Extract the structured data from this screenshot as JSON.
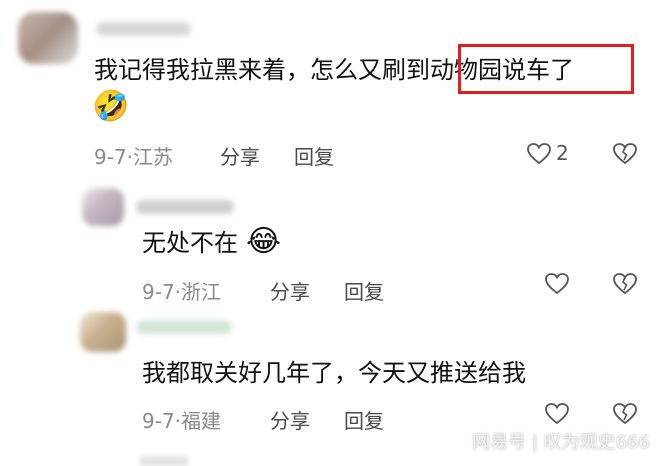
{
  "comments": [
    {
      "text_before": "我记得我拉黑来着，怎么又刷到",
      "text_highlight": "动物园说车了",
      "emoji": "🤣",
      "date": "9-7",
      "separator": "·",
      "location": "江苏",
      "share_label": "分享",
      "reply_label": "回复",
      "like_count": "2"
    },
    {
      "text": "无处不在",
      "emoji": "😂",
      "date": "9-7",
      "separator": "·",
      "location": "浙江",
      "share_label": "分享",
      "reply_label": "回复"
    },
    {
      "text": "我都取关好几年了，今天又推送给我",
      "date": "9-7",
      "separator": "·",
      "location": "福建",
      "share_label": "分享",
      "reply_label": "回复"
    }
  ],
  "watermark": "网易号 | 叹为观史666",
  "colors": {
    "highlight_border": "#e41e1e",
    "meta_text": "#8a8a8a"
  },
  "icons": [
    "heart-outline-icon",
    "broken-heart-icon"
  ]
}
